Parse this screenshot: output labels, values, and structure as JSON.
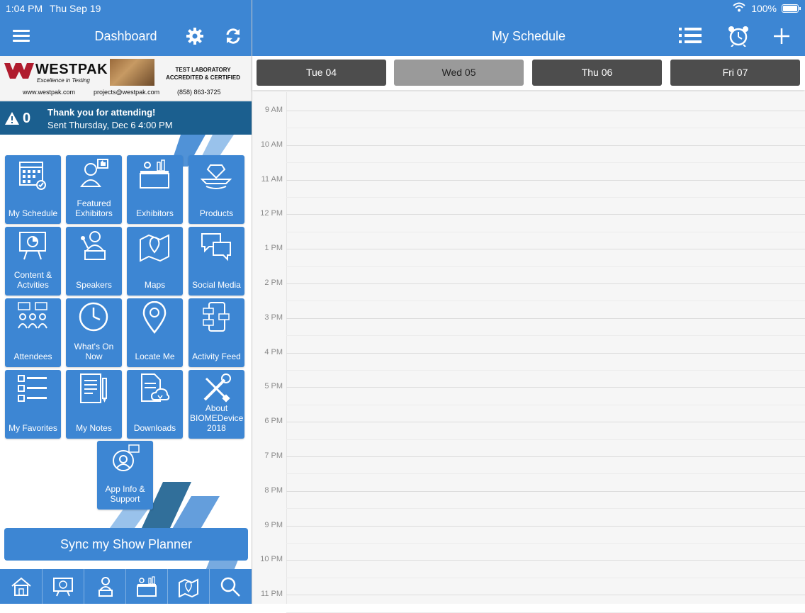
{
  "status": {
    "time": "1:04 PM",
    "date": "Thu Sep 19",
    "battery": "100%"
  },
  "left_header": {
    "title": "Dashboard"
  },
  "banner": {
    "brand": "WESTPAK",
    "tagline": "Excellence in Testing",
    "line1": "TEST LABORATORY",
    "line2": "ACCREDITED & CERTIFIED",
    "website": "www.westpak.com",
    "email": "projects@westpak.com",
    "phone": "(858) 863-3725"
  },
  "alert": {
    "count": "0",
    "title": "Thank you for attending!",
    "subtitle": "Sent Thursday, Dec 6 4:00 PM"
  },
  "tiles": {
    "my_schedule": "My Schedule",
    "featured_exhibitors": "Featured Exhibitors",
    "exhibitors": "Exhibitors",
    "products": "Products",
    "content_activities": "Content & Actvities",
    "speakers": "Speakers",
    "maps": "Maps",
    "social_media": "Social Media",
    "attendees": "Attendees",
    "whats_on_now": "What's On Now",
    "locate_me": "Locate Me",
    "activity_feed": "Activity Feed",
    "my_favorites": "My Favorites",
    "my_notes": "My Notes",
    "downloads": "Downloads",
    "about": "About BIOMEDevice 2018",
    "app_info": "App Info & Support"
  },
  "sync_button": "Sync my Show Planner",
  "right_header": {
    "title": "My Schedule"
  },
  "days": [
    "Tue 04",
    "Wed 05",
    "Thu 06",
    "Fri 07"
  ],
  "selected_day": "Wed 05",
  "time_labels": [
    "9 AM",
    "10 AM",
    "11 AM",
    "12 PM",
    "1 PM",
    "2 PM",
    "3 PM",
    "4 PM",
    "5 PM",
    "6 PM",
    "7 PM",
    "8 PM",
    "9 PM",
    "10 PM",
    "11 PM"
  ],
  "colors": {
    "accent": "#3d86d3",
    "alert_bg": "#1b5f8f",
    "day_tab": "#4d4d4d",
    "day_tab_selected": "#9a9a9a"
  },
  "icons": {
    "menu": "hamburger-icon",
    "settings": "gear-icon",
    "refresh": "refresh-icon",
    "list": "list-icon",
    "alarm": "alarm-clock-icon",
    "add": "plus-icon"
  }
}
